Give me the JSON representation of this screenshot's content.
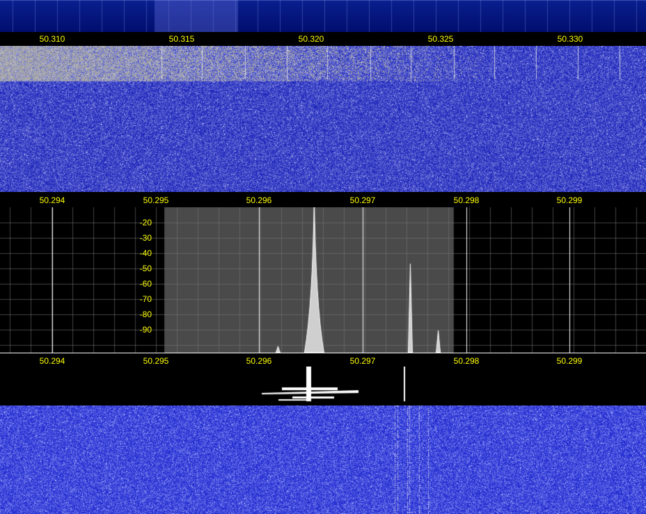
{
  "app": {
    "colors": {
      "label": "#ffff00",
      "waterfall_blue": "#1c2fd8",
      "spectrum_bg": "#000000",
      "passband": "#4a4a4a",
      "trace": "#cfcfcf"
    }
  },
  "top_scale": {
    "labels": [
      "50.310",
      "50.315",
      "50.320",
      "50.325",
      "50.330"
    ]
  },
  "mid_scale": {
    "labels": [
      "50.294",
      "50.295",
      "50.296",
      "50.297",
      "50.298",
      "50.299"
    ]
  },
  "db_axis": {
    "labels": [
      "-20",
      "-30",
      "-40",
      "-50",
      "-60",
      "-70",
      "-80",
      "-90"
    ]
  },
  "bottom_scale": {
    "labels": [
      "50.294",
      "50.295",
      "50.296",
      "50.297",
      "50.298",
      "50.299"
    ]
  },
  "spectrum": {
    "freq_range_mhz": [
      50.2935,
      50.29975
    ],
    "passband_mhz": [
      50.29509,
      50.29789
    ],
    "peaks": [
      {
        "freq": 50.29654,
        "level": 1.0
      },
      {
        "freq": 50.29747,
        "level": 0.56
      },
      {
        "freq": 50.29774,
        "level": 0.14
      },
      {
        "freq": 50.29619,
        "level": 0.04
      }
    ]
  }
}
